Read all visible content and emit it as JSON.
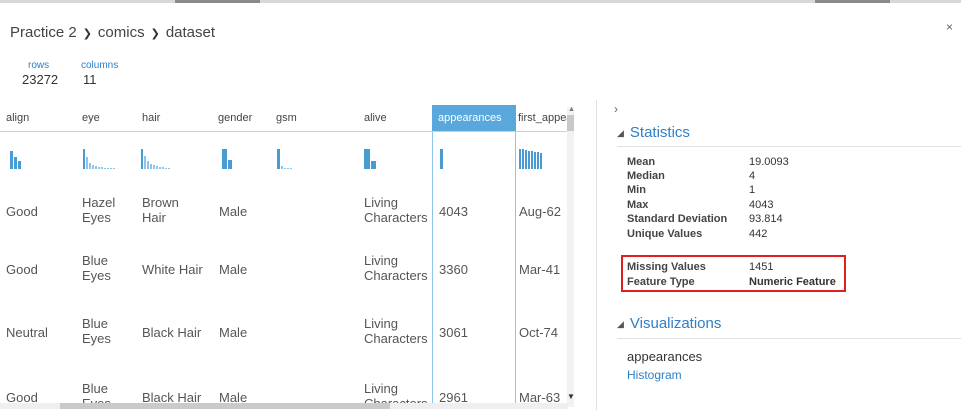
{
  "breadcrumb": {
    "part1": "Practice 2",
    "part2": "comics",
    "part3": "dataset"
  },
  "summary": {
    "rows_label": "rows",
    "rows_value": "23272",
    "columns_label": "columns",
    "columns_value": "11"
  },
  "columns": [
    {
      "name": "align"
    },
    {
      "name": "eye"
    },
    {
      "name": "hair"
    },
    {
      "name": "gender"
    },
    {
      "name": "gsm"
    },
    {
      "name": "alive"
    },
    {
      "name": "appearances"
    },
    {
      "name": "first_appea"
    }
  ],
  "selected_column": "appearances",
  "rows": [
    {
      "align": "Good",
      "eye": "Hazel Eyes",
      "hair": "Brown Hair",
      "gender": "Male",
      "alive": "Living Characters",
      "appearances": "4043",
      "first_appearance": "Aug-62"
    },
    {
      "align": "Good",
      "eye": "Blue Eyes",
      "hair": "White Hair",
      "gender": "Male",
      "alive": "Living Characters",
      "appearances": "3360",
      "first_appearance": "Mar-41"
    },
    {
      "align": "Neutral",
      "eye": "Blue Eyes",
      "hair": "Black Hair",
      "gender": "Male",
      "alive": "Living Characters",
      "appearances": "3061",
      "first_appearance": "Oct-74"
    },
    {
      "align": "Good",
      "eye": "Blue Eyes",
      "hair": "Black Hair",
      "gender": "Male",
      "alive": "Living Characters",
      "appearances": "2961",
      "first_appearance": "Mar-63"
    }
  ],
  "statistics": {
    "title": "Statistics",
    "items": [
      {
        "label": "Mean",
        "value": "19.0093"
      },
      {
        "label": "Median",
        "value": "4"
      },
      {
        "label": "Min",
        "value": "1"
      },
      {
        "label": "Max",
        "value": "4043"
      },
      {
        "label": "Standard Deviation",
        "value": "93.814"
      },
      {
        "label": "Unique Values",
        "value": "442"
      },
      {
        "label": "Missing Values",
        "value": "1451"
      },
      {
        "label": "Feature Type",
        "value": "Numeric Feature"
      }
    ]
  },
  "visualizations": {
    "title": "Visualizations",
    "feature": "appearances",
    "link": "Histogram"
  },
  "colors": {
    "accent": "#2f7fc7",
    "selected_header": "#5aa7dc",
    "highlight": "#e02020",
    "bars": "#4a9bd4"
  },
  "icons": {
    "breadcrumb_separator": "chevron-right-icon",
    "close": "close-icon",
    "collapse": "triangle-down-icon",
    "expand": "chevron-right-icon"
  }
}
